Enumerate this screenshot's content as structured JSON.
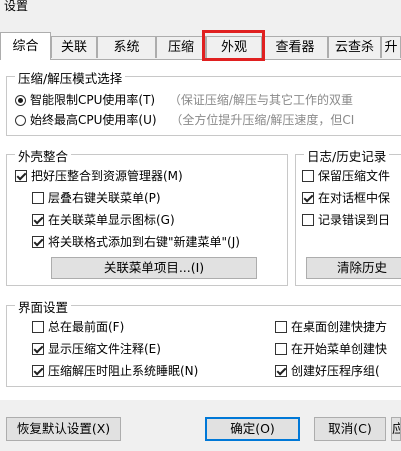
{
  "window": {
    "title": "设置"
  },
  "tabs": [
    {
      "label": "综合",
      "active": true
    },
    {
      "label": "关联"
    },
    {
      "label": "系统"
    },
    {
      "label": "压缩"
    },
    {
      "label": "外观",
      "highlighted": true
    },
    {
      "label": "查看器"
    },
    {
      "label": "云查杀"
    },
    {
      "label": "升"
    }
  ],
  "mode_group": {
    "title": "压缩/解压模式选择",
    "options": [
      {
        "label": "智能限制CPU使用率(T)",
        "hint": "（保证压缩/解压与其它工作的双重",
        "selected": true
      },
      {
        "label": "始终最高CPU使用率(U)",
        "hint": "（全方位提升压缩/解压速度，但CI",
        "selected": false
      }
    ]
  },
  "shell_group": {
    "title": "外壳整合",
    "items": [
      {
        "label": "把好压整合到资源管理器(M)",
        "checked": true
      },
      {
        "label": "层叠右键关联菜单(P)",
        "checked": false
      },
      {
        "label": "在关联菜单显示图标(G)",
        "checked": true
      },
      {
        "label": "将关联格式添加到右键\"新建菜单\"(J)",
        "checked": true
      }
    ],
    "button": "关联菜单项目...(I)"
  },
  "log_group": {
    "title": "日志/历史记录",
    "items": [
      {
        "label": "保留压缩文件",
        "checked": false
      },
      {
        "label": "在对话框中保",
        "checked": true
      },
      {
        "label": "记录错误到日",
        "checked": false
      }
    ],
    "button": "清除历史"
  },
  "ui_group": {
    "title": "界面设置",
    "left": [
      {
        "label": "总在最前面(F)",
        "checked": false
      },
      {
        "label": "显示压缩文件注释(E)",
        "checked": true
      },
      {
        "label": "压缩解压时阻止系统睡眠(N)",
        "checked": true
      }
    ],
    "right": [
      {
        "label": "在桌面创建快捷方",
        "checked": false
      },
      {
        "label": "在开始菜单创建快",
        "checked": false
      },
      {
        "label": "创建好压程序组(",
        "checked": true
      }
    ]
  },
  "footer": {
    "restore": "恢复默认设置(X)",
    "ok": "确定(O)",
    "cancel": "取消(C)",
    "apply": "应"
  }
}
